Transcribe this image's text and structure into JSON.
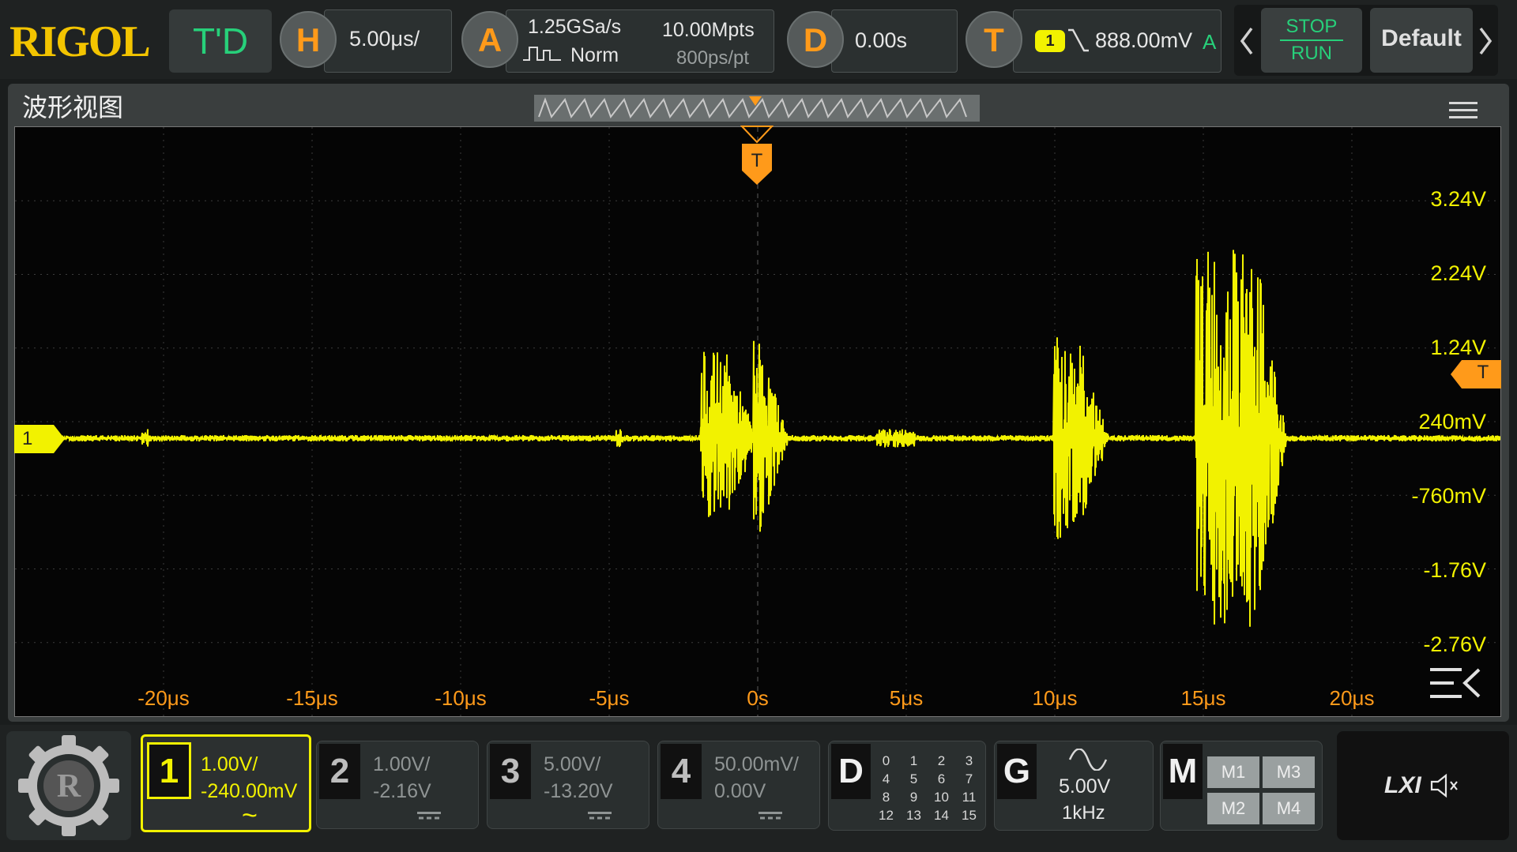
{
  "app": {
    "logo": "RIGOL",
    "run_mode": "T'D"
  },
  "timebase": {
    "label": "H",
    "value": "5.00μs/"
  },
  "acquire": {
    "label": "A",
    "sample_rate": "1.25GSa/s",
    "memory_depth": "10.00Mpts",
    "mode": "Norm",
    "resolution": "800ps/pt"
  },
  "delay": {
    "label": "D",
    "value": "0.00s"
  },
  "trigger": {
    "label": "T",
    "source": "1",
    "level": "888.00mV",
    "sweep": "A"
  },
  "controls": {
    "stop": "STOP",
    "run": "RUN",
    "default": "Default"
  },
  "waveform_view": {
    "title": "波形视图",
    "trigger_marker": "T",
    "channel_marker": "1",
    "y_ticks": [
      "3.24V",
      "2.24V",
      "1.24V",
      "240mV",
      "-760mV",
      "-1.76V",
      "-2.76V"
    ],
    "x_ticks": [
      "-20μs",
      "-15μs",
      "-10μs",
      "-5μs",
      "0s",
      "5μs",
      "10μs",
      "15μs",
      "20μs"
    ]
  },
  "channels": [
    {
      "num": "1",
      "scale": "1.00V/",
      "offset": "-240.00mV",
      "coupling": "~",
      "active": true
    },
    {
      "num": "2",
      "scale": "1.00V/",
      "offset": "-2.16V",
      "coupling": "",
      "active": false
    },
    {
      "num": "3",
      "scale": "5.00V/",
      "offset": "-13.20V",
      "coupling": "",
      "active": false
    },
    {
      "num": "4",
      "scale": "50.00mV/",
      "offset": "0.00V",
      "coupling": "",
      "active": false
    }
  ],
  "digital": {
    "label": "D",
    "bits": [
      "0",
      "1",
      "2",
      "3",
      "4",
      "5",
      "6",
      "7",
      "8",
      "9",
      "10",
      "11",
      "12",
      "13",
      "14",
      "15"
    ]
  },
  "generator": {
    "label": "G",
    "amplitude": "5.00V",
    "frequency": "1kHz"
  },
  "math": {
    "label": "M",
    "items": [
      "M1",
      "M3",
      "M2",
      "M4"
    ]
  },
  "status": {
    "lxi": "LXI"
  },
  "colors": {
    "ch1": "#f2f200",
    "accent": "#ff9a1a",
    "green": "#27d07a"
  }
}
